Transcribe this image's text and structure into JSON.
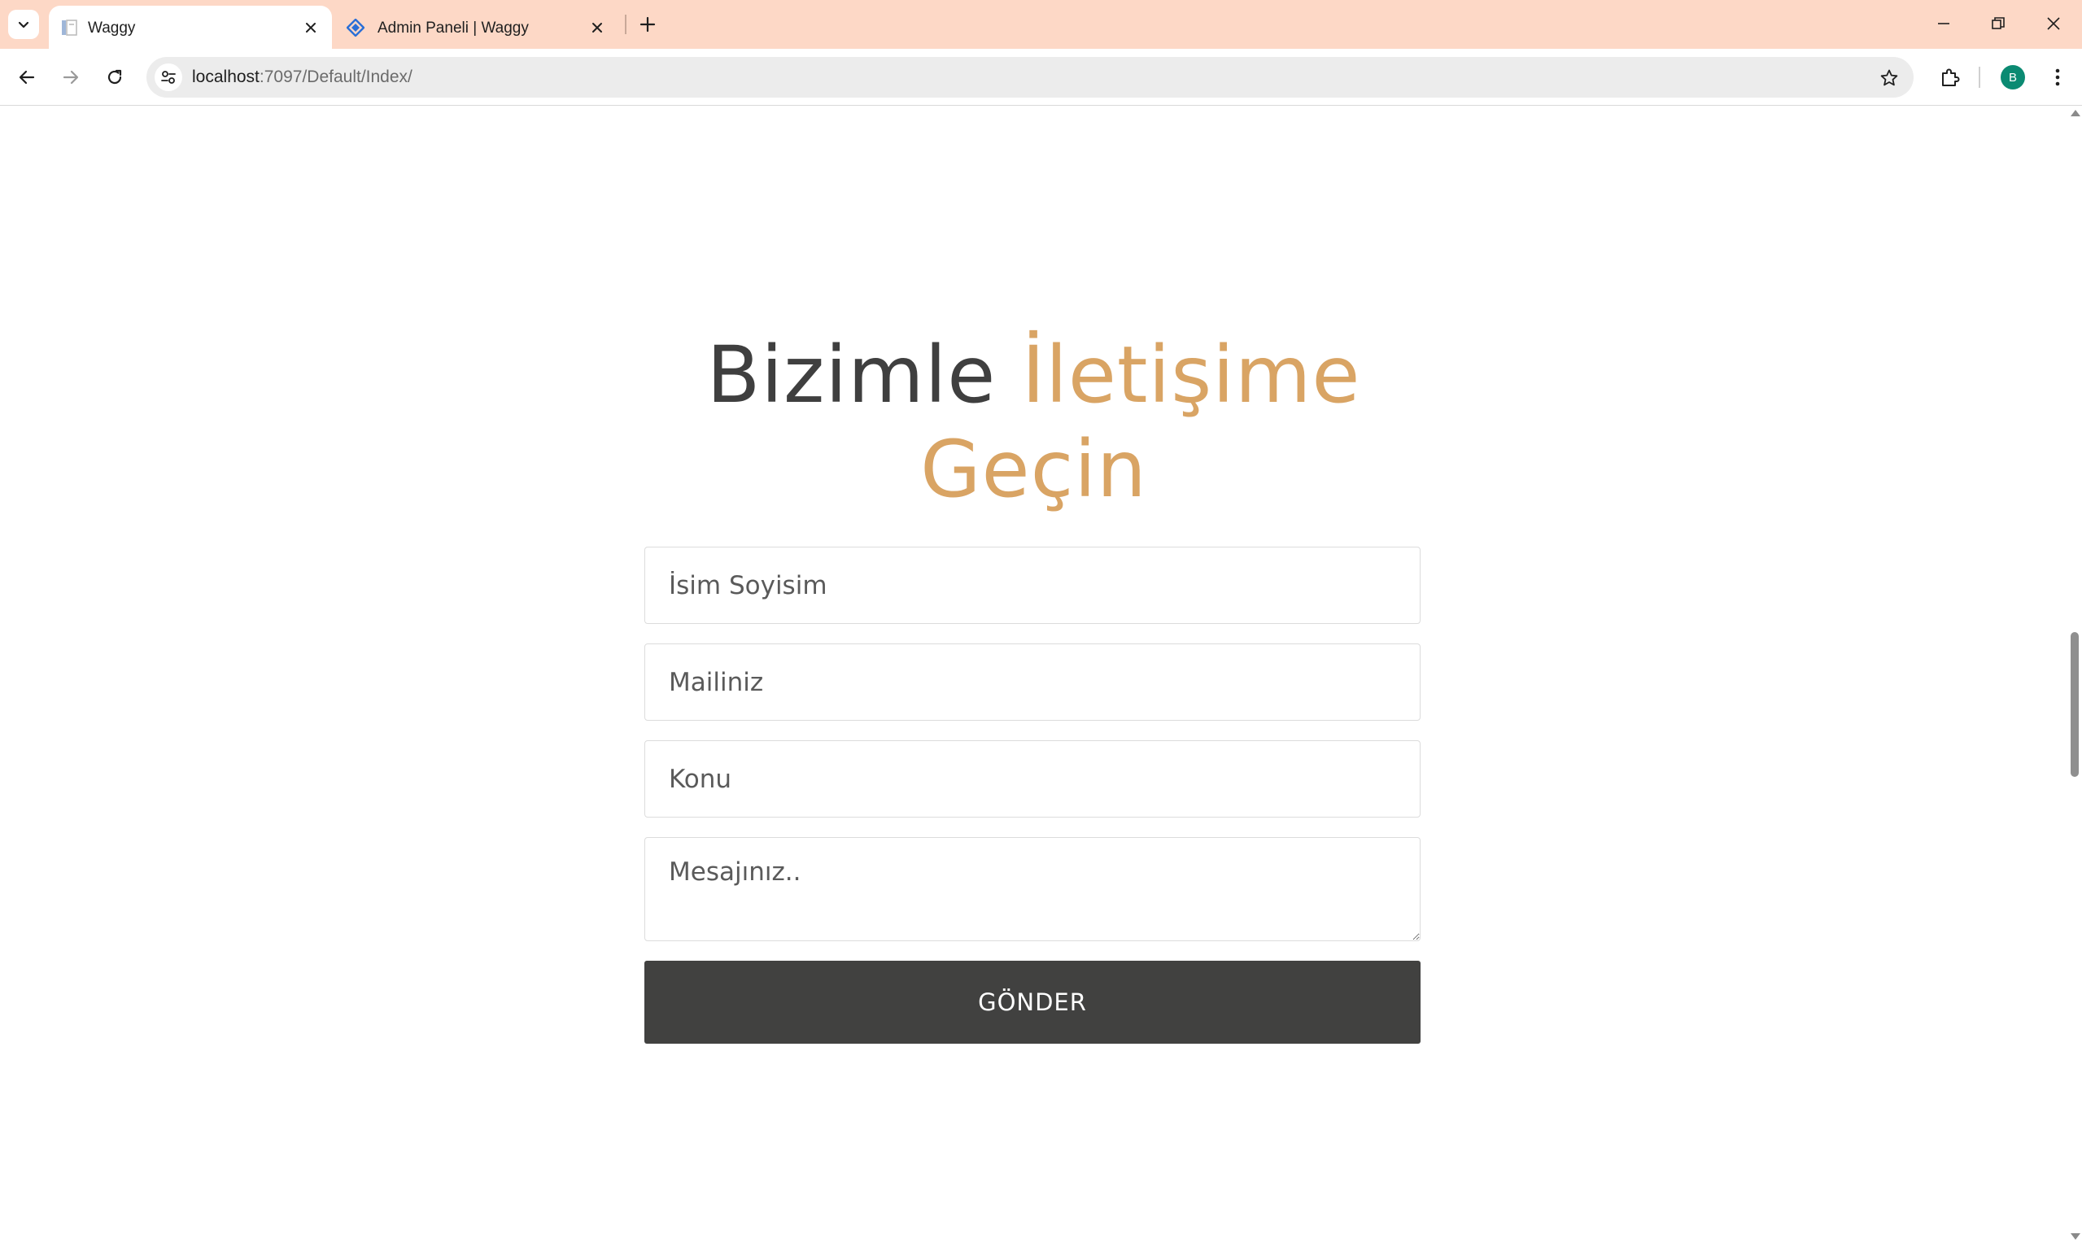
{
  "browser": {
    "tabs": [
      {
        "title": "Waggy",
        "active": true
      },
      {
        "title": "Admin Paneli | Waggy",
        "active": false
      }
    ],
    "url": {
      "host": "localhost",
      "path": ":7097/Default/Index/"
    },
    "profile_initial": "B"
  },
  "contact": {
    "heading_plain": "Bizimle ",
    "heading_accent_1": "İletişime",
    "heading_accent_2": "Geçin",
    "name_placeholder": "İsim Soyisim",
    "email_placeholder": "Mailiniz",
    "subject_placeholder": "Konu",
    "message_placeholder": "Mesajınız..",
    "submit_label": "GÖNDER"
  },
  "colors": {
    "accent": "#d9a464",
    "heading": "#3f3f3f",
    "button": "#414140",
    "tabstrip": "#fdd8c6"
  }
}
